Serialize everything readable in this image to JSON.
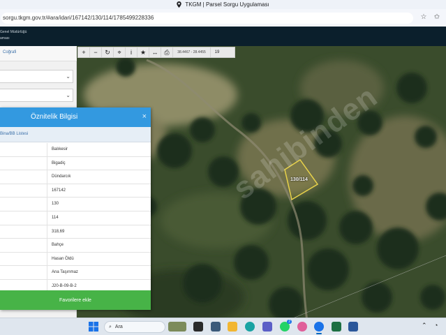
{
  "browser": {
    "title": "TKGM | Parsel Sorgu Uygulaması",
    "url": "sorgu.tkgm.gov.tr/#ara/idari/167142/130/114/1785499228336"
  },
  "app_header": {
    "line1": "Genel Müdürlüğü",
    "line2": "aması"
  },
  "left_panel": {
    "tab_label": "Coğrafi"
  },
  "map": {
    "coords": "38.4467 - 28.4455",
    "zoom": "19",
    "parcel_label": "130/114",
    "watermark": "sahibinden"
  },
  "dialog": {
    "title": "Öznitelik Bilgisi",
    "close": "×",
    "sub_link": "Bina/BB Listesi",
    "rows": [
      {
        "value": "Balıkesir"
      },
      {
        "value": "Bigadiç"
      },
      {
        "value": "Dündarcık"
      },
      {
        "value": "167142"
      },
      {
        "value": "130"
      },
      {
        "value": "114"
      },
      {
        "value": "318,69"
      },
      {
        "value": "Bahçe"
      },
      {
        "value": "Hasan Öldü"
      },
      {
        "value": "Ana Taşınmaz"
      },
      {
        "value": "J20-B-09-B-2"
      }
    ],
    "favorite_button": "Favorilere ekle"
  },
  "taskbar": {
    "search_placeholder": "Ara",
    "whatsapp_badge": "2"
  },
  "colors": {
    "dialog_header": "#3399e0",
    "favorite_button": "#47b347",
    "app_header": "#0b1f2c",
    "parcel_outline": "#e8d24a"
  }
}
